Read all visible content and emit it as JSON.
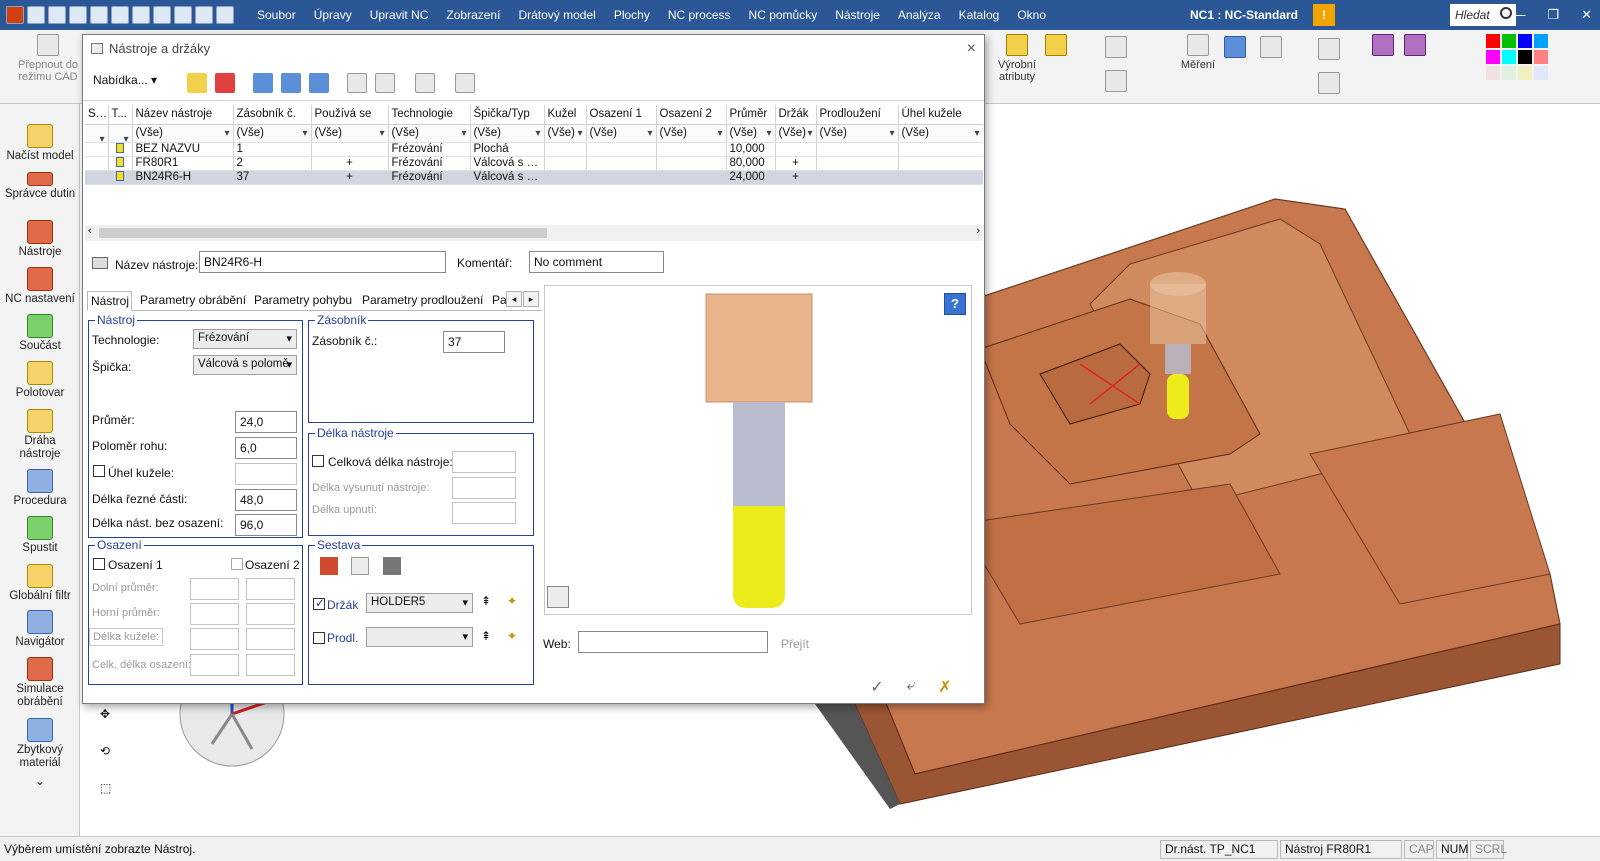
{
  "app": {
    "title": "NC1 : NC-Standard",
    "menus": [
      "Soubor",
      "Úpravy",
      "Upravit NC",
      "Zobrazení",
      "Drátový model",
      "Plochy",
      "NC process",
      "NC pomůcky",
      "Nástroje",
      "Analýza",
      "Katalog",
      "Okno"
    ],
    "search_placeholder": "Hledat",
    "warning_glyph": "!",
    "win_minimize": "—",
    "win_restore": "❐",
    "win_close": "✕"
  },
  "ribbon": {
    "switch_cad": "Přepnout do režimu CAD",
    "production_attrs": "Výrobní atributy",
    "measure": "Měření"
  },
  "sidebar": {
    "items": [
      "Načíst model",
      "Správce dutin",
      "Nástroje",
      "NC nastavení",
      "Součást",
      "Polotovar",
      "Dráha nástroje",
      "Procedura",
      "Spustit",
      "Globální filtr",
      "Navigátor",
      "Simulace obrábění",
      "Zbytkový materiál"
    ],
    "more": "⌄"
  },
  "status": {
    "message": "Výběrem umístění zobrazte Nástroj.",
    "drawing": "Dr.nást.  TP_NC1",
    "tool": "Nástroj  FR80R1",
    "cap": "CAP",
    "num": "NUM",
    "scrl": "SCRL"
  },
  "dialog": {
    "title": "Nástroje a držáky",
    "close": "×",
    "menu_button": "Nabídka...",
    "columns": [
      "S...",
      "T...",
      "Název nástroje",
      "Zásobník č.",
      "Používá se",
      "Technologie",
      "Špička/Typ",
      "Kužel",
      "Osazení 1",
      "Osazení 2",
      "Průměr",
      "Držák",
      "Prodloužení",
      "Úhel kužele"
    ],
    "filter_all": "(Vše)",
    "rows": [
      {
        "name": "BEZ NÁZVU",
        "slot": "1",
        "used": "",
        "tech": "Frézování",
        "tip": "Plochá",
        "taper": "",
        "s1": "",
        "s2": "",
        "diam": "10,000",
        "holder": "",
        "ext": "",
        "angle": ""
      },
      {
        "name": "FR80R1",
        "slot": "2",
        "used": "+",
        "tech": "Frézování",
        "tip": "Válcová s p...",
        "taper": "",
        "s1": "",
        "s2": "",
        "diam": "80,000",
        "holder": "+",
        "ext": "",
        "angle": ""
      },
      {
        "name": "BN24R6-H",
        "slot": "37",
        "used": "+",
        "tech": "Frézování",
        "tip": "Válcová s p...",
        "taper": "",
        "s1": "",
        "s2": "",
        "diam": "24,000",
        "holder": "+",
        "ext": "",
        "angle": ""
      }
    ],
    "name_label": "Název nástroje:",
    "name_value": "BN24R6-H",
    "comment_label": "Komentář:",
    "comment_value": "No comment",
    "tabs": [
      "Nástroj",
      "Parametry obrábění",
      "Parametry pohybu",
      "Parametry prodloužení",
      "Pa"
    ],
    "tab_prev": "◂",
    "tab_next": "▸",
    "tool_group": {
      "legend": "Nástroj",
      "tech_label": "Technologie:",
      "tech_value": "Frézování",
      "tip_label": "Špička:",
      "tip_value": "Válcová s polomě",
      "diam_label": "Průměr:",
      "diam_value": "24,0",
      "corner_label": "Poloměr rohu:",
      "corner_value": "6,0",
      "taper_label": "Úhel kužele:",
      "cut_label": "Délka řezné části:",
      "cut_value": "48,0",
      "len_label": "Délka nást. bez osazení:",
      "len_value": "96,0"
    },
    "magazine_group": {
      "legend": "Zásobník",
      "slot_label": "Zásobník č.:",
      "slot_value": "37"
    },
    "length_group": {
      "legend": "Délka nástroje",
      "total_label": "Celková délka nástroje:",
      "stickout_label": "Délka vysunutí nástroje:",
      "clamp_label": "Délka upnutí:"
    },
    "shoulder_group": {
      "legend": "Osazení",
      "s1_label": "Osazení 1",
      "s2_label": "Osazení 2",
      "lower_label": "Dolní průměr:",
      "upper_label": "Horní průměr:",
      "taper_len_label": "Délka kužele:",
      "total_len_label": "Celk. délka osazení:"
    },
    "assembly_group": {
      "legend": "Sestava",
      "holder_label": "Držák",
      "holder_value": "HOLDER5",
      "ext_label": "Prodl."
    },
    "web_label": "Web:",
    "go_label": "Přejít",
    "help_glyph": "?",
    "ok_glyph": "✓",
    "apply_glyph": "⤶",
    "cancel_glyph": "✗"
  },
  "colors": {
    "title_bar": "#2b5797",
    "model": "#c8784e",
    "group_border": "#25419a",
    "flute": "#ecec1c",
    "shank": "#b8bccc",
    "holder": "#e9b58c"
  }
}
